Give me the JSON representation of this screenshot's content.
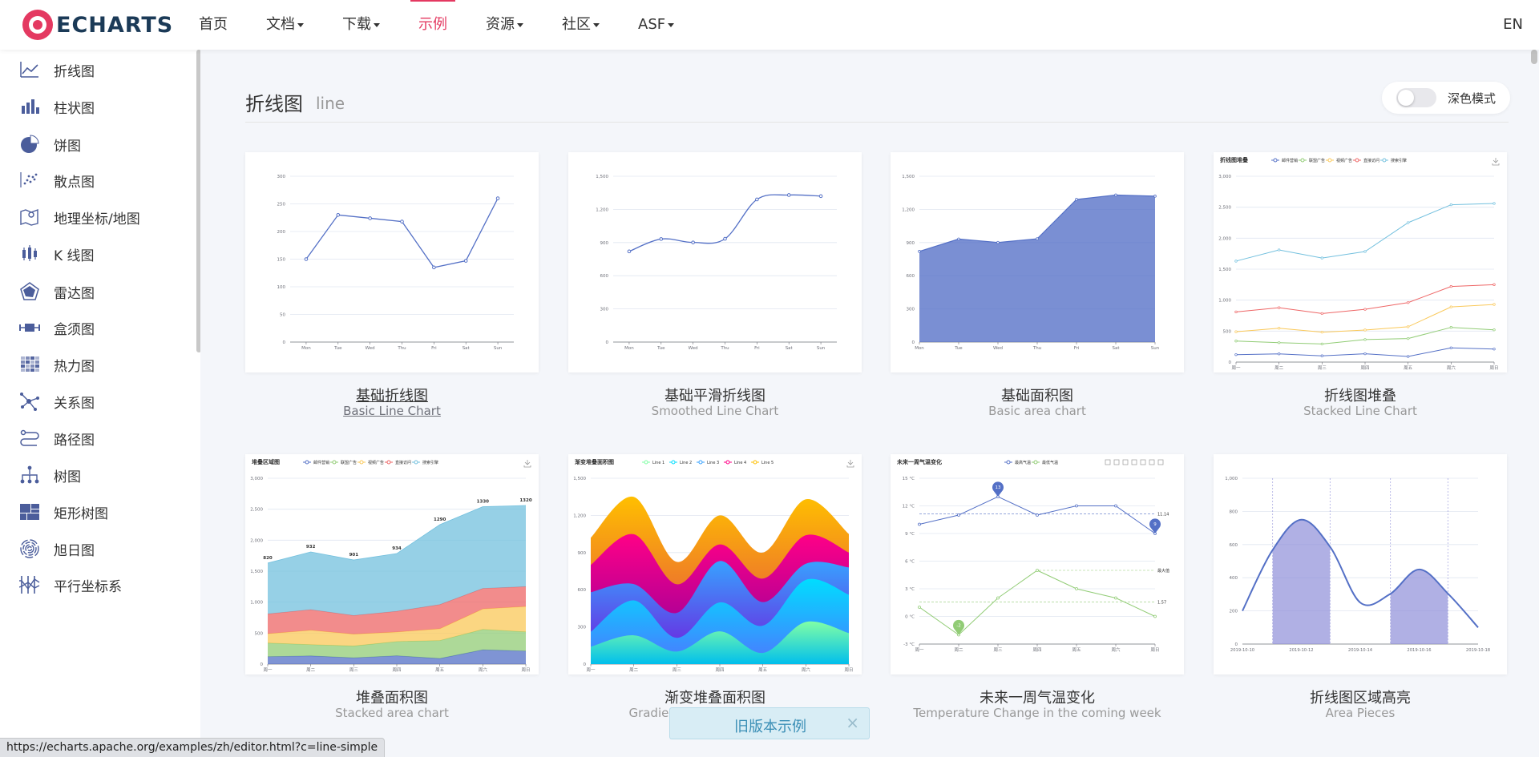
{
  "header": {
    "logo_text": "ECHARTS",
    "nav": [
      {
        "label": "首页",
        "dropdown": false
      },
      {
        "label": "文档",
        "dropdown": true
      },
      {
        "label": "下载",
        "dropdown": true
      },
      {
        "label": "示例",
        "dropdown": false,
        "active": true
      },
      {
        "label": "资源",
        "dropdown": true
      },
      {
        "label": "社区",
        "dropdown": true
      },
      {
        "label": "ASF",
        "dropdown": true
      }
    ],
    "lang": "EN"
  },
  "sidebar": {
    "items": [
      {
        "label": "折线图",
        "icon": "line-chart-icon"
      },
      {
        "label": "柱状图",
        "icon": "bar-chart-icon"
      },
      {
        "label": "饼图",
        "icon": "pie-chart-icon"
      },
      {
        "label": "散点图",
        "icon": "scatter-chart-icon"
      },
      {
        "label": "地理坐标/地图",
        "icon": "map-icon"
      },
      {
        "label": "K 线图",
        "icon": "candlestick-icon"
      },
      {
        "label": "雷达图",
        "icon": "radar-chart-icon"
      },
      {
        "label": "盒须图",
        "icon": "boxplot-icon"
      },
      {
        "label": "热力图",
        "icon": "heatmap-icon"
      },
      {
        "label": "关系图",
        "icon": "graph-icon"
      },
      {
        "label": "路径图",
        "icon": "lines-icon"
      },
      {
        "label": "树图",
        "icon": "tree-icon"
      },
      {
        "label": "矩形树图",
        "icon": "treemap-icon"
      },
      {
        "label": "旭日图",
        "icon": "sunburst-icon"
      },
      {
        "label": "平行坐标系",
        "icon": "parallel-icon"
      }
    ]
  },
  "section": {
    "title": "折线图",
    "subtitle": "line",
    "dark_mode_label": "深色模式"
  },
  "cards": [
    {
      "title": "基础折线图",
      "subtitle": "Basic Line Chart"
    },
    {
      "title": "基础平滑折线图",
      "subtitle": "Smoothed Line Chart"
    },
    {
      "title": "基础面积图",
      "subtitle": "Basic area chart"
    },
    {
      "title": "折线图堆叠",
      "subtitle": "Stacked Line Chart"
    },
    {
      "title": "堆叠面积图",
      "subtitle": "Stacked area chart"
    },
    {
      "title": "渐变堆叠面积图",
      "subtitle": "Gradient Stacked Area Chart"
    },
    {
      "title": "未来一周气温变化",
      "subtitle": "Temperature Change in the coming week"
    },
    {
      "title": "折线图区域高亮",
      "subtitle": "Area Pieces"
    }
  ],
  "notice": {
    "text": "旧版本示例",
    "close": "×"
  },
  "status_url": "https://echarts.apache.org/examples/zh/editor.html?c=line-simple",
  "colors": {
    "accent": "#e43961",
    "series_blue": "#5470c6",
    "series_green": "#91cc75",
    "series_yellow": "#fac858",
    "series_red": "#ee6666",
    "series_cyan": "#73c0de"
  },
  "chart_data": [
    {
      "type": "line",
      "title": "",
      "categories": [
        "Mon",
        "Tue",
        "Wed",
        "Thu",
        "Fri",
        "Sat",
        "Sun"
      ],
      "series": [
        {
          "values": [
            150,
            230,
            224,
            218,
            135,
            147,
            260
          ]
        }
      ],
      "ylim": [
        0,
        300
      ],
      "yticks": [
        0,
        50,
        100,
        150,
        200,
        250,
        300
      ]
    },
    {
      "type": "line",
      "smooth": true,
      "title": "",
      "categories": [
        "Mon",
        "Tue",
        "Wed",
        "Thu",
        "Fri",
        "Sat",
        "Sun"
      ],
      "series": [
        {
          "values": [
            820,
            932,
            901,
            934,
            1290,
            1330,
            1320
          ]
        }
      ],
      "ylim": [
        0,
        1500
      ],
      "yticks": [
        "0",
        "300",
        "600",
        "900",
        "1,200",
        "1,500"
      ]
    },
    {
      "type": "area",
      "title": "",
      "categories": [
        "Mon",
        "Tue",
        "Wed",
        "Thu",
        "Fri",
        "Sat",
        "Sun"
      ],
      "series": [
        {
          "values": [
            820,
            932,
            901,
            934,
            1290,
            1330,
            1320
          ]
        }
      ],
      "ylim": [
        0,
        1500
      ],
      "yticks": [
        "0",
        "300",
        "600",
        "900",
        "1,200",
        "1,500"
      ]
    },
    {
      "type": "line",
      "stacked": true,
      "title": "折线图堆叠",
      "categories": [
        "周一",
        "周二",
        "周三",
        "周四",
        "周五",
        "周六",
        "周日"
      ],
      "series": [
        {
          "name": "邮件营销",
          "values": [
            120,
            132,
            101,
            134,
            90,
            230,
            210
          ]
        },
        {
          "name": "联盟广告",
          "values": [
            340,
            314,
            292,
            364,
            380,
            560,
            520
          ]
        },
        {
          "name": "视频广告",
          "values": [
            490,
            546,
            483,
            518,
            570,
            890,
            930
          ]
        },
        {
          "name": "直接访问",
          "values": [
            810,
            878,
            784,
            852,
            960,
            1220,
            1250
          ]
        },
        {
          "name": "搜索引擎",
          "values": [
            1630,
            1810,
            1680,
            1784,
            2250,
            2540,
            2560
          ]
        }
      ],
      "ylim": [
        0,
        3000
      ],
      "yticks": [
        "0",
        "500",
        "1,000",
        "1,500",
        "2,000",
        "2,500",
        "3,000"
      ],
      "legend_position": "top"
    },
    {
      "type": "area",
      "stacked": true,
      "title": "堆叠区域图",
      "categories": [
        "周一",
        "周二",
        "周三",
        "周四",
        "周五",
        "周六",
        "周日"
      ],
      "series": [
        {
          "name": "邮件营销",
          "values": [
            120,
            132,
            101,
            134,
            90,
            230,
            210
          ]
        },
        {
          "name": "联盟广告",
          "values": [
            340,
            314,
            292,
            364,
            380,
            560,
            520
          ]
        },
        {
          "name": "视频广告",
          "values": [
            490,
            546,
            483,
            518,
            570,
            890,
            930
          ]
        },
        {
          "name": "直接访问",
          "values": [
            810,
            878,
            784,
            852,
            960,
            1220,
            1250
          ]
        },
        {
          "name": "搜索引擎",
          "values": [
            1630,
            1810,
            1680,
            1784,
            2250,
            2540,
            2560
          ]
        }
      ],
      "data_labels": [
        "820",
        "932",
        "901",
        "934",
        "1290",
        "1330",
        "1320"
      ],
      "ylim": [
        0,
        3000
      ],
      "yticks": [
        "0",
        "500",
        "1,000",
        "1,500",
        "2,000",
        "2,500",
        "3,000"
      ],
      "legend_position": "top"
    },
    {
      "type": "area",
      "stacked": true,
      "smooth": true,
      "title": "渐变堆叠面积图",
      "categories": [
        "周一",
        "周二",
        "周三",
        "周四",
        "周五",
        "周六",
        "周日"
      ],
      "series": [
        {
          "name": "Line 1",
          "values": [
            140,
            232,
            101,
            264,
            90,
            340,
            250
          ]
        },
        {
          "name": "Line 2",
          "values": [
            120,
            282,
            111,
            234,
            220,
            340,
            310
          ]
        },
        {
          "name": "Line 3",
          "values": [
            320,
            132,
            201,
            334,
            190,
            130,
            220
          ]
        },
        {
          "name": "Line 4",
          "values": [
            220,
            402,
            231,
            134,
            190,
            230,
            120
          ]
        },
        {
          "name": "Line 5",
          "values": [
            220,
            302,
            181,
            234,
            210,
            290,
            150
          ]
        }
      ],
      "ylim": [
        0,
        1500
      ],
      "yticks": [
        "0",
        "300",
        "600",
        "900",
        "1,200",
        "1,500"
      ],
      "legend_position": "top"
    },
    {
      "type": "line",
      "title": "未来一周气温变化",
      "categories": [
        "周一",
        "周二",
        "周三",
        "周四",
        "周五",
        "周六",
        "周日"
      ],
      "series": [
        {
          "name": "最高气温",
          "values": [
            10,
            11,
            13,
            11,
            12,
            12,
            9
          ]
        },
        {
          "name": "最低气温",
          "values": [
            1,
            -2,
            2,
            5,
            3,
            2,
            0
          ]
        }
      ],
      "annotations": [
        "13",
        "9",
        "-2",
        "11.14",
        "1.57",
        "最大值"
      ],
      "ylim": [
        -3,
        15
      ],
      "yticks": [
        "-3 °C",
        "0 °C",
        "3 °C",
        "6 °C",
        "9 °C",
        "12 °C",
        "15 °C"
      ],
      "legend_position": "top"
    },
    {
      "type": "line",
      "smooth": true,
      "title": "",
      "categories": [
        "2019-10-10",
        "2019-10-12",
        "2019-10-14",
        "2019-10-16",
        "2019-10-18"
      ],
      "series": [
        {
          "values": [
            200,
            560,
            750,
            580,
            250,
            300,
            450,
            300,
            100
          ]
        }
      ],
      "ylim": [
        0,
        1000
      ],
      "yticks": [
        "0",
        "200",
        "400",
        "600",
        "800",
        "1,000"
      ]
    }
  ]
}
